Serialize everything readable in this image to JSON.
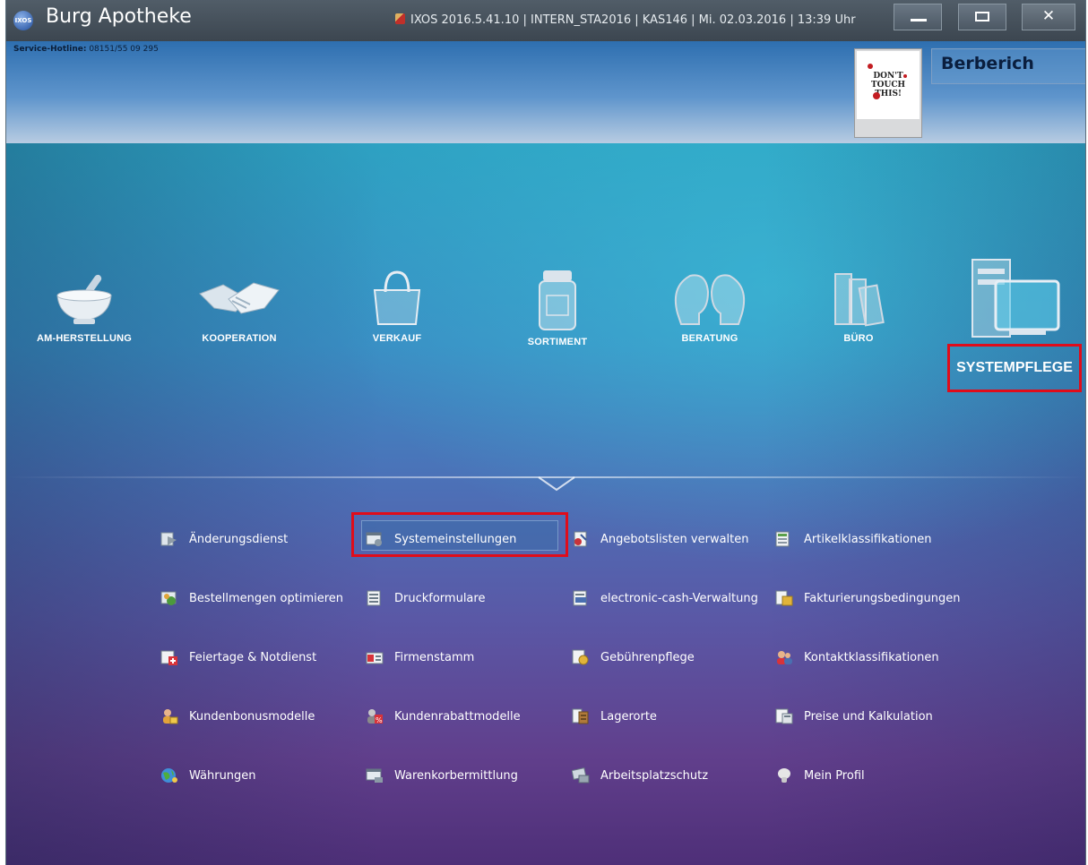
{
  "titlebar": {
    "app_icon_text": "IXOS",
    "app_title": "Burg Apotheke",
    "info": "IXOS 2016.5.41.10  |  INTERN_STA2016  |  KAS146  |  Mi. 02.03.2016  |  13:39 Uhr"
  },
  "infobar": {
    "hotline_label": "Service-Hotline:",
    "hotline_number": "08151/55 09 295",
    "note_text": "DON'T TOUCH THIS!",
    "user_name": "Berberich"
  },
  "categories": [
    {
      "label": "AM-HERSTELLUNG",
      "icon": "mortar-pestle-icon"
    },
    {
      "label": "KOOPERATION",
      "icon": "handshake-icon"
    },
    {
      "label": "VERKAUF",
      "icon": "shopping-bag-icon"
    },
    {
      "label": "SORTIMENT",
      "icon": "medicine-jar-icon"
    },
    {
      "label": "BERATUNG",
      "icon": "consultation-heads-icon"
    },
    {
      "label": "BÜRO",
      "icon": "binders-icon"
    },
    {
      "label": "SYSTEMPFLEGE",
      "icon": "computer-icon",
      "active": true
    }
  ],
  "menu": [
    {
      "label": "Änderungsdienst",
      "icon": "update-icon"
    },
    {
      "label": "Systemeinstellungen",
      "icon": "settings-window-icon",
      "selected": true
    },
    {
      "label": "Angebotslisten verwalten",
      "icon": "offer-list-icon"
    },
    {
      "label": "Artikelklassifikationen",
      "icon": "classification-icon"
    },
    {
      "label": "Bestellmengen optimieren",
      "icon": "order-optimize-icon"
    },
    {
      "label": "Druckformulare",
      "icon": "print-form-icon"
    },
    {
      "label": "electronic-cash-Verwaltung",
      "icon": "ec-card-icon"
    },
    {
      "label": "Fakturierungsbedingungen",
      "icon": "invoice-icon"
    },
    {
      "label": "Feiertage & Notdienst",
      "icon": "calendar-plus-icon"
    },
    {
      "label": "Firmenstamm",
      "icon": "company-icon"
    },
    {
      "label": "Gebührenpflege",
      "icon": "fees-icon"
    },
    {
      "label": "Kontaktklassifikationen",
      "icon": "contacts-icon"
    },
    {
      "label": "Kundenbonusmodelle",
      "icon": "customer-bonus-icon"
    },
    {
      "label": "Kundenrabattmodelle",
      "icon": "discount-icon"
    },
    {
      "label": "Lagerorte",
      "icon": "storage-icon"
    },
    {
      "label": "Preise und Kalkulation",
      "icon": "pricing-icon"
    },
    {
      "label": "Währungen",
      "icon": "currency-globe-icon"
    },
    {
      "label": "Warenkorbermittlung",
      "icon": "basket-window-icon"
    },
    {
      "label": "Arbeitsplatzschutz",
      "icon": "workstation-lock-icon"
    },
    {
      "label": "Mein Profil",
      "icon": "profile-icon"
    }
  ],
  "colors": {
    "highlight_border": "#e00c1a",
    "titlebar": "#47525c",
    "text": "#ffffff"
  }
}
